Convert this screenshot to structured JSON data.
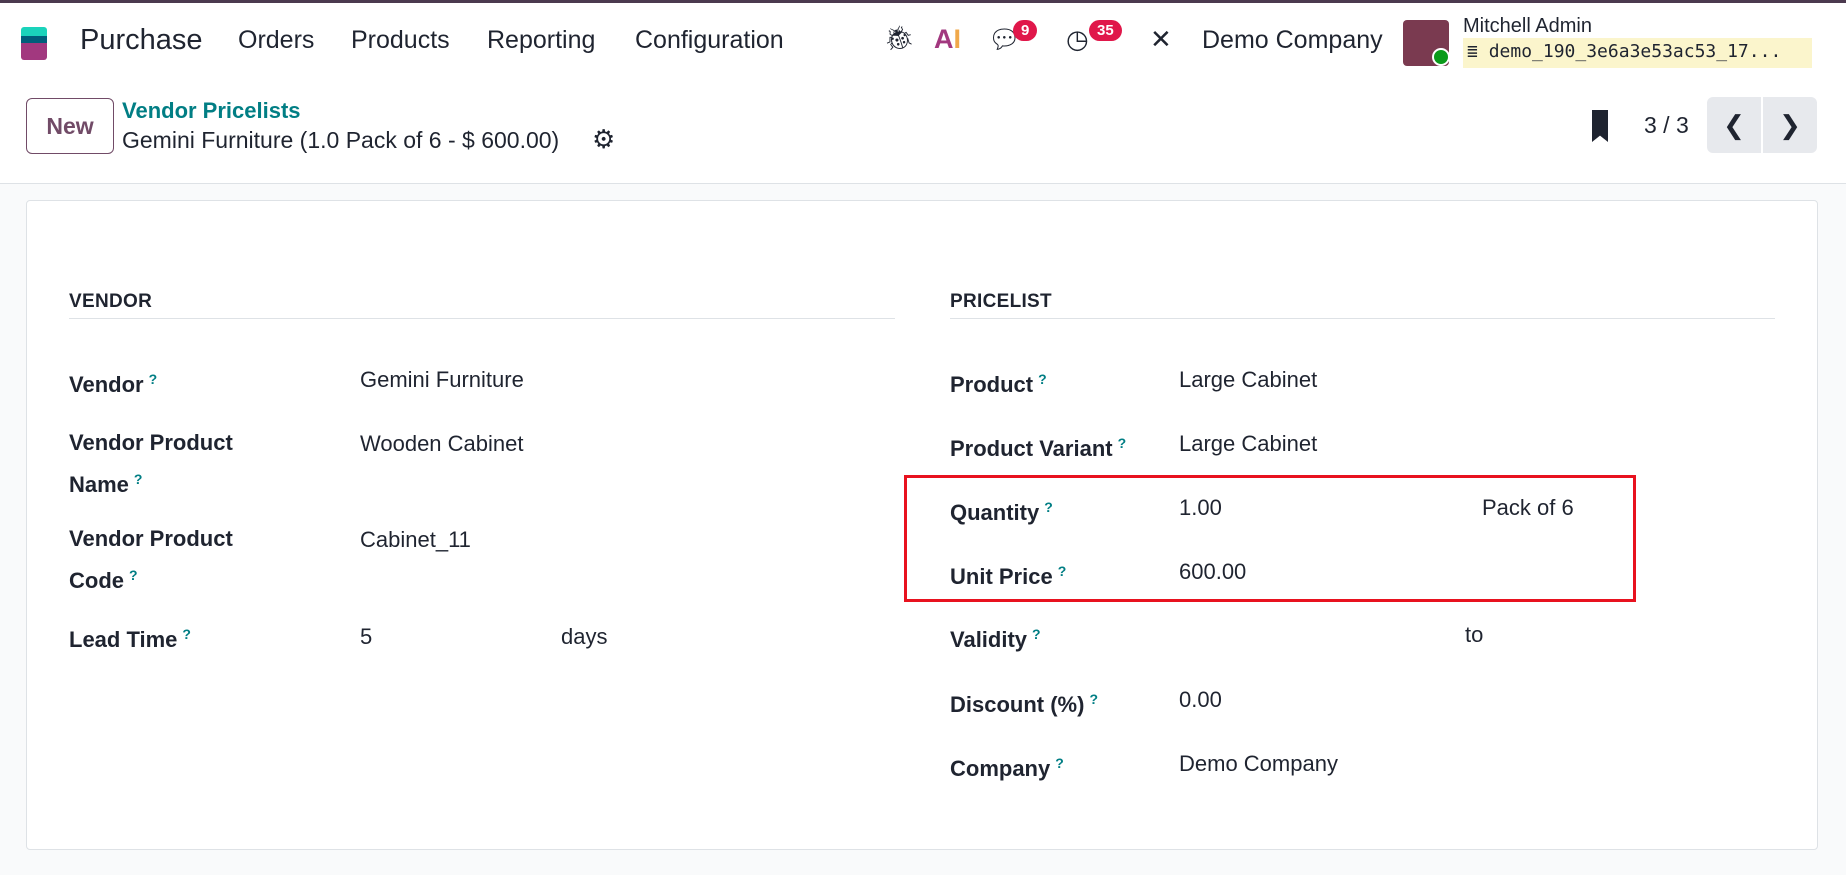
{
  "navbar": {
    "app": "Purchase",
    "menu": [
      "Orders",
      "Products",
      "Reporting",
      "Configuration"
    ],
    "messages_count": "9",
    "activities_count": "35",
    "company": "Demo Company",
    "user": "Mitchell Admin",
    "database": "demo_190_3e6a3e53ac53_17..."
  },
  "control": {
    "new_label": "New",
    "breadcrumb": "Vendor Pricelists",
    "record_title": "Gemini Furniture (1.0 Pack of 6 - $ 600.00)",
    "pager": "3 / 3"
  },
  "vendor": {
    "title": "VENDOR",
    "fields": [
      {
        "label": "Vendor",
        "value": "Gemini Furniture"
      },
      {
        "label": "Vendor Product",
        "label2": "Name",
        "value": "Wooden Cabinet"
      },
      {
        "label": "Vendor Product",
        "label2": "Code",
        "value": "Cabinet_11"
      },
      {
        "label": "Lead Time",
        "value": "5",
        "unit": "days"
      }
    ]
  },
  "pricelist": {
    "title": "PRICELIST",
    "fields": [
      {
        "label": "Product",
        "value": "Large Cabinet"
      },
      {
        "label": "Product Variant",
        "value": "Large Cabinet"
      },
      {
        "label": "Quantity",
        "value": "1.00",
        "unit": "Pack of 6"
      },
      {
        "label": "Unit Price",
        "value": "600.00"
      },
      {
        "label": "Validity",
        "value": "",
        "sep": "to"
      },
      {
        "label": "Discount (%)",
        "value": "0.00"
      },
      {
        "label": "Company",
        "value": "Demo Company"
      }
    ]
  },
  "help_mark": "?"
}
